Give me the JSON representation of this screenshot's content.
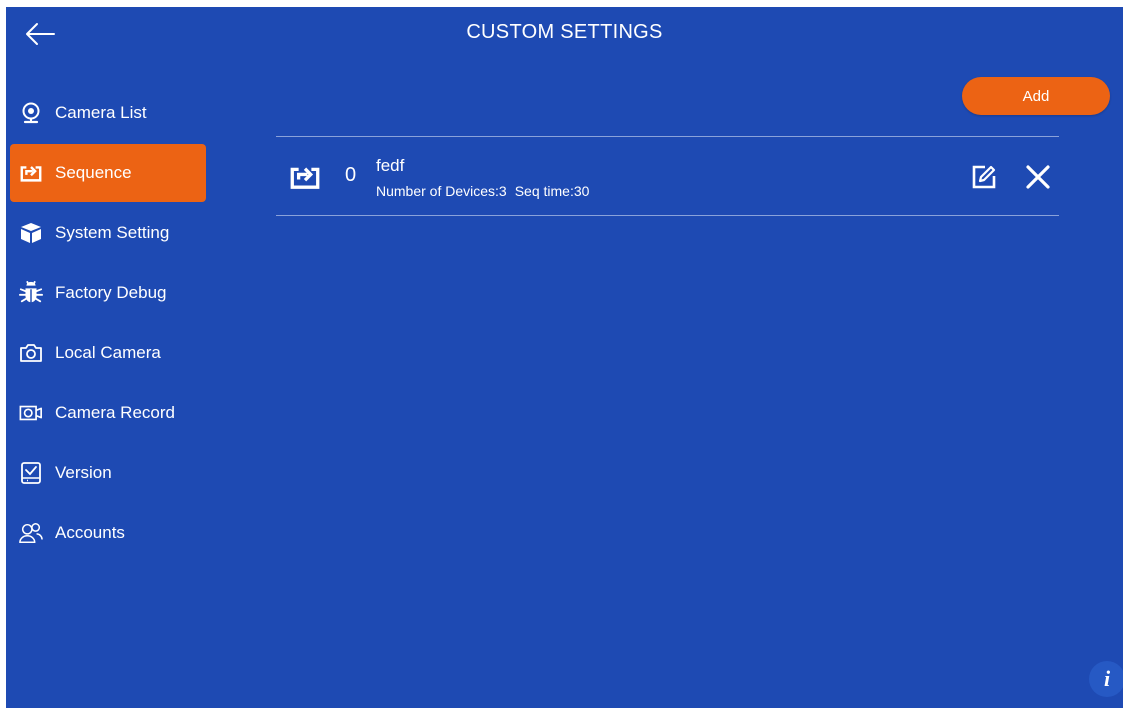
{
  "header": {
    "title": "CUSTOM SETTINGS",
    "back_icon": "arrow-left-icon"
  },
  "sidebar": {
    "items": [
      {
        "label": "Camera List",
        "icon": "webcam-icon",
        "active": false
      },
      {
        "label": "Sequence",
        "icon": "sequence-icon",
        "active": true
      },
      {
        "label": "System Setting",
        "icon": "box-icon",
        "active": false
      },
      {
        "label": "Factory Debug",
        "icon": "bug-icon",
        "active": false
      },
      {
        "label": "Local Camera",
        "icon": "camera-icon",
        "active": false
      },
      {
        "label": "Camera Record",
        "icon": "video-camera-icon",
        "active": false
      },
      {
        "label": "Version",
        "icon": "version-icon",
        "active": false
      },
      {
        "label": "Accounts",
        "icon": "users-icon",
        "active": false
      }
    ]
  },
  "main": {
    "add_label": "Add",
    "sequences": [
      {
        "index": "0",
        "name": "fedf",
        "devices": "Number of Devices:3",
        "seq_time": "Seq time:30"
      }
    ]
  },
  "info_label": "i",
  "colors": {
    "background": "#1e4ab3",
    "accent": "#ec6314",
    "text": "#ffffff"
  }
}
